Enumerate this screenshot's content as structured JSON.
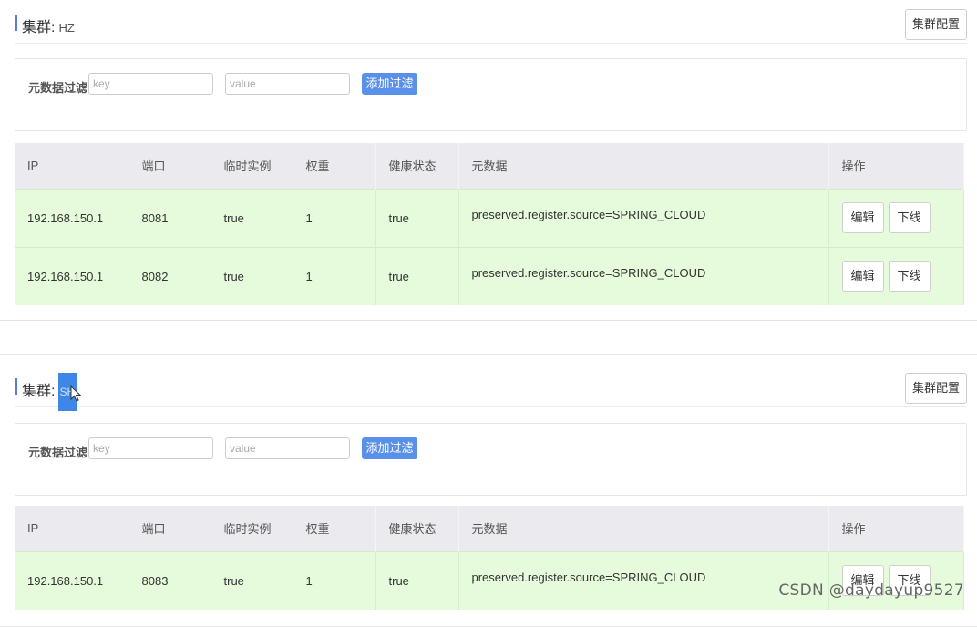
{
  "clusters": [
    {
      "title_label": "集群:",
      "name": "HZ",
      "config_button": "集群配置",
      "filter": {
        "label": "元数据过滤",
        "key_placeholder": "key",
        "value_placeholder": "value",
        "add_button": "添加过滤"
      },
      "columns": [
        "IP",
        "端口",
        "临时实例",
        "权重",
        "健康状态",
        "元数据",
        "操作"
      ],
      "rows": [
        {
          "ip": "192.168.150.1",
          "port": "8081",
          "ephemeral": "true",
          "weight": "1",
          "healthy": "true",
          "metadata": "preserved.register.source=SPRING_CLOUD",
          "edit": "编辑",
          "offline": "下线"
        },
        {
          "ip": "192.168.150.1",
          "port": "8082",
          "ephemeral": "true",
          "weight": "1",
          "healthy": "true",
          "metadata": "preserved.register.source=SPRING_CLOUD",
          "edit": "编辑",
          "offline": "下线"
        }
      ]
    },
    {
      "title_label": "集群:",
      "name": "SH",
      "config_button": "集群配置",
      "filter": {
        "label": "元数据过滤",
        "key_placeholder": "key",
        "value_placeholder": "value",
        "add_button": "添加过滤"
      },
      "columns": [
        "IP",
        "端口",
        "临时实例",
        "权重",
        "健康状态",
        "元数据",
        "操作"
      ],
      "rows": [
        {
          "ip": "192.168.150.1",
          "port": "8083",
          "ephemeral": "true",
          "weight": "1",
          "healthy": "true",
          "metadata": "preserved.register.source=SPRING_CLOUD",
          "edit": "编辑",
          "offline": "下线"
        }
      ]
    }
  ],
  "watermark": "CSDN @daydayup9527",
  "colors": {
    "accent": "#5a7bd8",
    "primary_button": "#5990ea",
    "row_background": "#e5fbdb",
    "header_background": "#ebebef",
    "selection": "#3f86e6"
  }
}
